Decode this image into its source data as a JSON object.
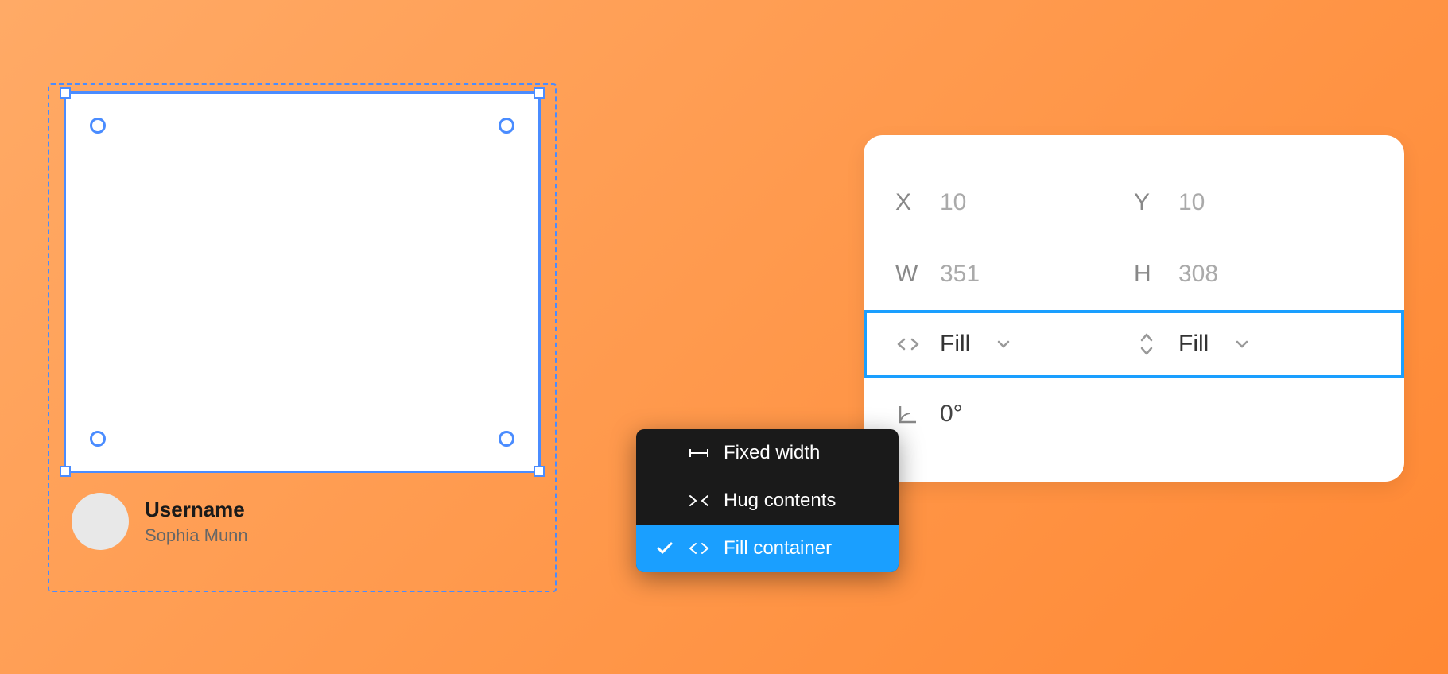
{
  "canvas": {
    "username_label": "Username",
    "username_value": "Sophia Munn"
  },
  "properties": {
    "x_label": "X",
    "x_value": "10",
    "y_label": "Y",
    "y_value": "10",
    "w_label": "W",
    "w_value": "351",
    "h_label": "H",
    "h_value": "308",
    "width_sizing": "Fill",
    "height_sizing": "Fill",
    "rotation_value": "0°"
  },
  "dropdown": {
    "items": [
      {
        "label": "Fixed width",
        "icon": "fixed-width-icon",
        "selected": false
      },
      {
        "label": "Hug contents",
        "icon": "hug-contents-icon",
        "selected": false
      },
      {
        "label": "Fill container",
        "icon": "fill-container-icon",
        "selected": true
      }
    ]
  }
}
